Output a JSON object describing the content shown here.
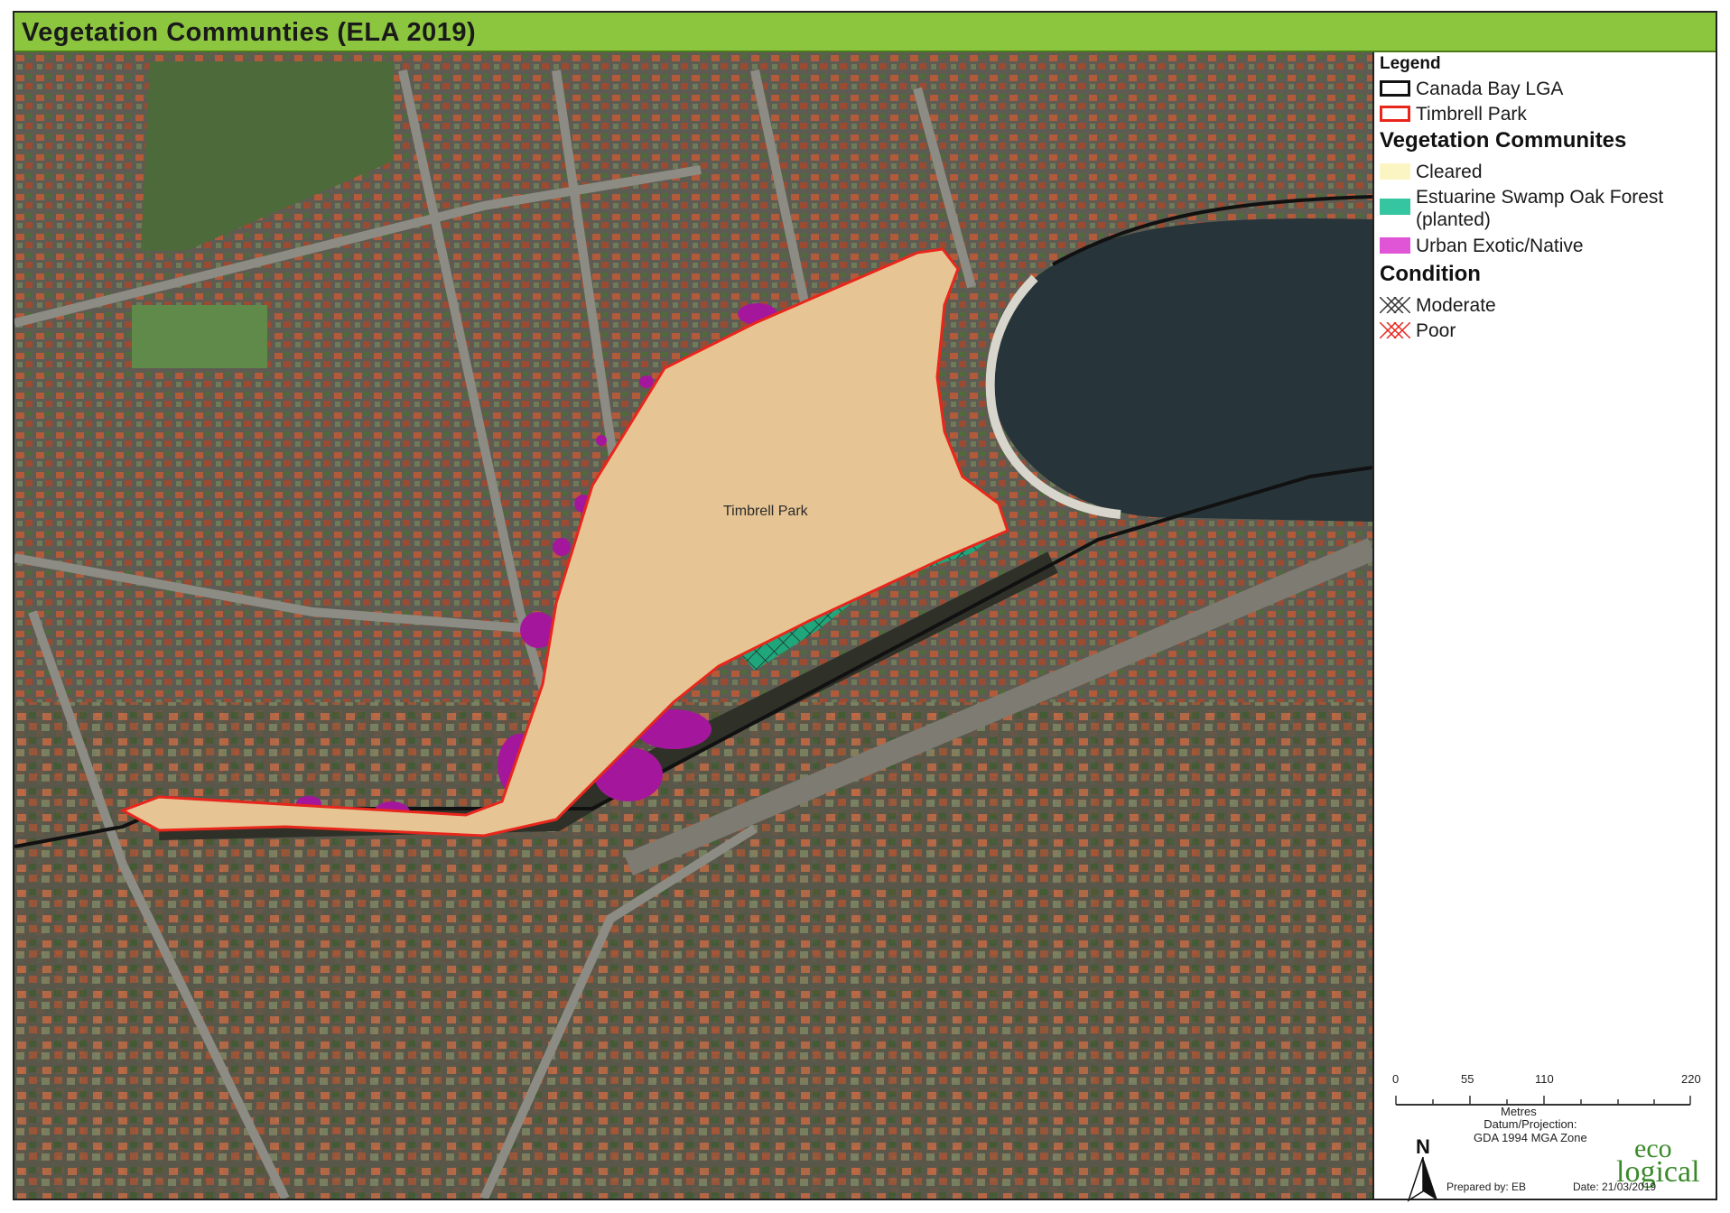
{
  "title": "Vegetation Communties (ELA 2019)",
  "map": {
    "park_label": "Timbrell Park"
  },
  "legend": {
    "heading": "Legend",
    "boundaries": [
      {
        "label": "Canada Bay LGA",
        "color": "#111111"
      },
      {
        "label": "Timbrell Park",
        "color": "#e8261c"
      }
    ],
    "veg_heading": "Vegetation Communites",
    "veg_items": [
      {
        "label": "Cleared",
        "color": "#fbf5c3"
      },
      {
        "label": "Estuarine Swamp Oak Forest (planted)",
        "color": "#35c5a0"
      },
      {
        "label": "Urban Exotic/Native",
        "color": "#e055d6"
      }
    ],
    "condition_heading": "Condition",
    "condition_items": [
      {
        "label": "Moderate",
        "hatch_color": "#333333"
      },
      {
        "label": "Poor",
        "hatch_color": "#e8261c"
      }
    ]
  },
  "scale": {
    "ticks": [
      "0",
      "55",
      "110",
      "220"
    ],
    "unit": "Metres"
  },
  "datum": {
    "line1": "Datum/Projection:",
    "line2": "GDA 1994 MGA Zone"
  },
  "north": "N",
  "logo": {
    "top": "eco",
    "bottom": "logical"
  },
  "prepared_by": "Prepared by: EB",
  "date": "Date: 21/03/2019"
}
